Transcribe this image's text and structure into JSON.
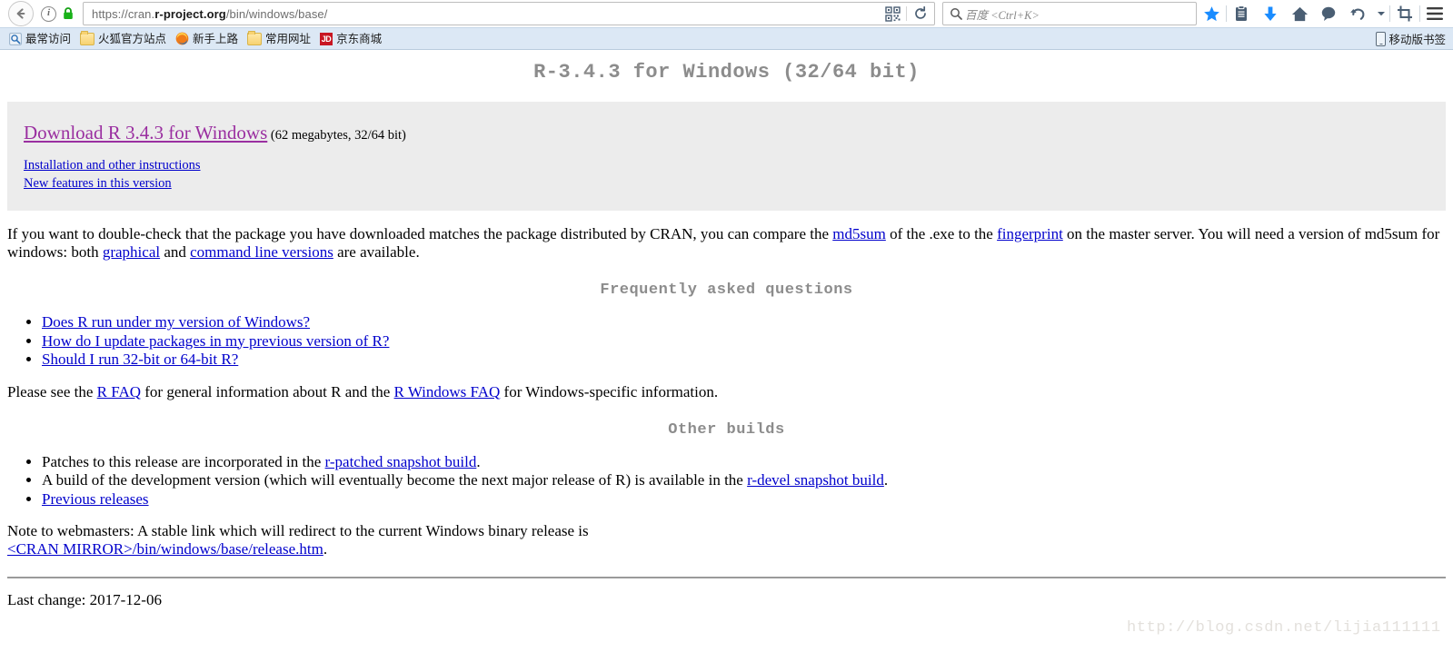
{
  "browser": {
    "back_icon": "back-arrow-icon",
    "info_icon": "page-info-icon",
    "lock_icon": "padlock-secure-icon",
    "url_prefix": "https://cran.",
    "url_domain": "r-project.org",
    "url_path": "/bin/windows/base/",
    "qr_icon": "qr-code-icon",
    "reload_icon": "reload-icon",
    "search_icon": "search-icon",
    "search_placeholder": "百度 <Ctrl+K>",
    "tools": [
      {
        "name": "bookmark-star-icon",
        "label": "★"
      },
      {
        "name": "reading-list-icon",
        "label": ""
      },
      {
        "name": "downloads-icon",
        "label": "↓"
      },
      {
        "name": "home-icon",
        "label": ""
      },
      {
        "name": "chat-bubble-icon",
        "label": ""
      },
      {
        "name": "undo-history-icon",
        "label": ""
      },
      {
        "name": "chevron-down-icon",
        "label": "▾"
      },
      {
        "name": "screenshot-crop-icon",
        "label": ""
      },
      {
        "name": "hamburger-menu-icon",
        "label": "☰"
      }
    ]
  },
  "bookmarks": {
    "items": [
      {
        "label": "最常访问",
        "icon": "most-visited-icon"
      },
      {
        "label": "火狐官方站点",
        "icon": "folder-icon"
      },
      {
        "label": "新手上路",
        "icon": "firefox-icon"
      },
      {
        "label": "常用网址",
        "icon": "folder-icon"
      },
      {
        "label": "京东商城",
        "icon": "jd-icon"
      }
    ],
    "mobile_label": "移动版书签",
    "mobile_icon": "mobile-phone-icon"
  },
  "page": {
    "title": "R-3.4.3 for Windows (32/64 bit)",
    "download": {
      "link": "Download R 3.4.3 for Windows",
      "note": " (62 megabytes, 32/64 bit)",
      "sub_links": [
        "Installation and other instructions",
        "New features in this version"
      ]
    },
    "md5_paragraph": {
      "part1": "If you want to double-check that the package you have downloaded matches the package distributed by CRAN, you can compare the ",
      "link1": "md5sum",
      "part2": " of the .exe to the ",
      "link2": "fingerprint",
      "part3": " on the master server. You will need a version of md5sum for windows: both ",
      "link3": "graphical",
      "part4": " and ",
      "link4": "command line versions",
      "part5": " are available."
    },
    "faq_title": "Frequently asked questions",
    "faq_items": [
      "Does R run under my version of Windows?",
      "How do I update packages in my previous version of R?",
      "Should I run 32-bit or 64-bit R?"
    ],
    "faq_paragraph": {
      "part1": "Please see the ",
      "link1": "R FAQ",
      "part2": " for general information about R and the ",
      "link2": "R Windows FAQ",
      "part3": " for Windows-specific information."
    },
    "other_builds_title": "Other builds",
    "other_builds": {
      "item1_pre": "Patches to this release are incorporated in the ",
      "item1_link": "r-patched snapshot build",
      "item1_post": ".",
      "item2_pre": "A build of the development version (which will eventually become the next major release of R) is available in the ",
      "item2_link": "r-devel snapshot build",
      "item2_post": ".",
      "item3_link": "Previous releases"
    },
    "webmaster_note": {
      "line1": "Note to webmasters: A stable link which will redirect to the current Windows binary release is",
      "link": "<CRAN MIRROR>/bin/windows/base/release.htm",
      "trailing": "."
    },
    "last_change": "Last change: 2017-12-06",
    "watermark": "http://blog.csdn.net/lijia111111"
  },
  "colors": {
    "link": "#0000cc",
    "visited_link": "#9a2fa0",
    "heading": "#8c8c8c",
    "box_bg": "#ececec",
    "bookmark_bar": "#dce8f5",
    "accent_blue": "#1a8cff"
  }
}
